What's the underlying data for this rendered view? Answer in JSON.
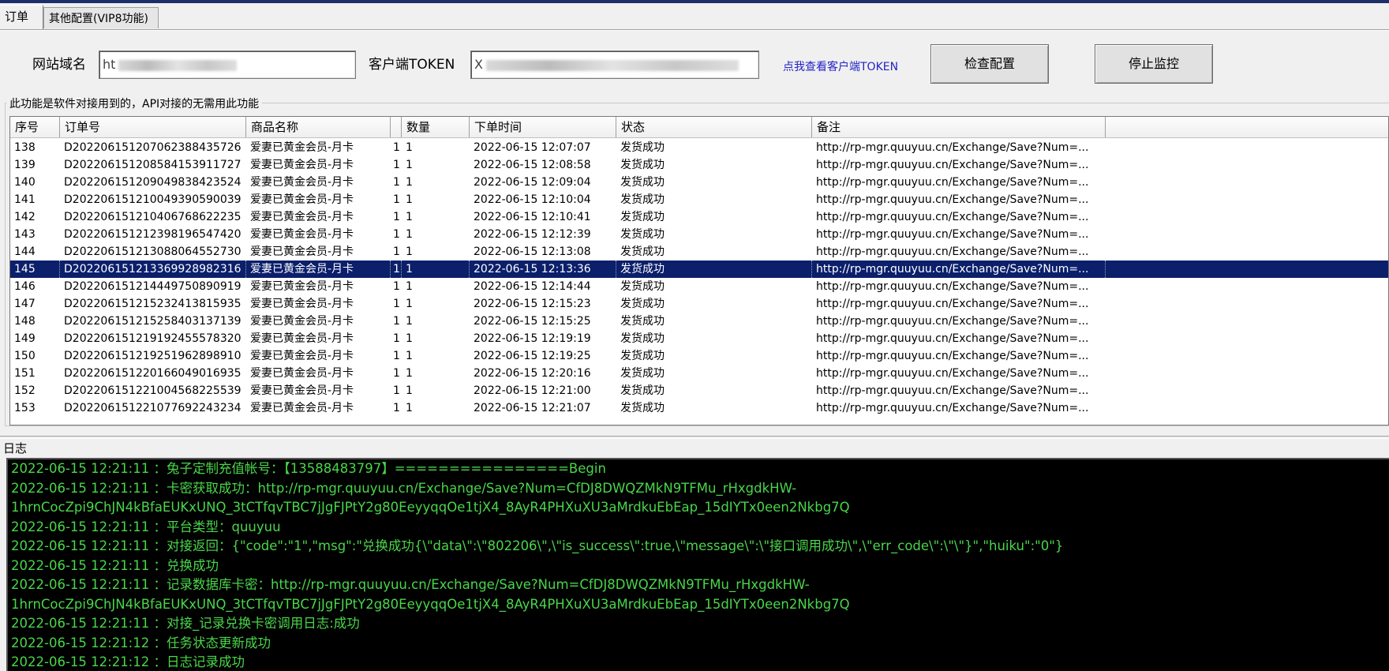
{
  "tabs": [
    {
      "label": "订单",
      "active": true
    },
    {
      "label": "其他配置(VIP8功能)",
      "active": false
    }
  ],
  "config": {
    "domain_label": "网站域名",
    "domain_value": "ht",
    "token_label": "客户端TOKEN",
    "token_value": "X",
    "token_link": "点我查看客户端TOKEN",
    "check_button": "检查配置",
    "stop_button": "停止监控"
  },
  "orders_group_title": "此功能是软件对接用到的，API对接的无需用此功能",
  "table": {
    "columns": [
      "序号",
      "订单号",
      "商品名称",
      "",
      "数量",
      "下单时间",
      "状态",
      "备注"
    ],
    "selected_row_index": 7,
    "rows": [
      [
        "138",
        "D20220615120706238843572​6",
        "爱妻已黄金会员-月卡",
        "1",
        "1",
        "2022-06-15 12:07:07",
        "发货成功",
        "http://rp-mgr.quuyuu.cn/Exchange/Save?Num=..."
      ],
      [
        "139",
        "D20220615120858415391172​7",
        "爱妻已黄金会员-月卡",
        "1",
        "1",
        "2022-06-15 12:08:58",
        "发货成功",
        "http://rp-mgr.quuyuu.cn/Exchange/Save?Num=..."
      ],
      [
        "140",
        "D20220615120904983842352​4",
        "爱妻已黄金会员-月卡",
        "1",
        "1",
        "2022-06-15 12:09:04",
        "发货成功",
        "http://rp-mgr.quuyuu.cn/Exchange/Save?Num=..."
      ],
      [
        "141",
        "D20220615121004939059003​9",
        "爱妻已黄金会员-月卡",
        "1",
        "1",
        "2022-06-15 12:10:04",
        "发货成功",
        "http://rp-mgr.quuyuu.cn/Exchange/Save?Num=..."
      ],
      [
        "142",
        "D20220615121040676862223​5",
        "爱妻已黄金会员-月卡",
        "1",
        "1",
        "2022-06-15 12:10:41",
        "发货成功",
        "http://rp-mgr.quuyuu.cn/Exchange/Save?Num=..."
      ],
      [
        "143",
        "D20220615121239819654742​0",
        "爱妻已黄金会员-月卡",
        "1",
        "1",
        "2022-06-15 12:12:39",
        "发货成功",
        "http://rp-mgr.quuyuu.cn/Exchange/Save?Num=..."
      ],
      [
        "144",
        "D20220615121308806455273​0",
        "爱妻已黄金会员-月卡",
        "1",
        "1",
        "2022-06-15 12:13:08",
        "发货成功",
        "http://rp-mgr.quuyuu.cn/Exchange/Save?Num=..."
      ],
      [
        "145",
        "D20220615121336992898231​6",
        "爱妻已黄金会员-月卡",
        "1",
        "1",
        "2022-06-15 12:13:36",
        "发货成功",
        "http://rp-mgr.quuyuu.cn/Exchange/Save?Num=..."
      ],
      [
        "146",
        "D20220615121444975089091​9",
        "爱妻已黄金会员-月卡",
        "1",
        "1",
        "2022-06-15 12:14:44",
        "发货成功",
        "http://rp-mgr.quuyuu.cn/Exchange/Save?Num=..."
      ],
      [
        "147",
        "D20220615121523241381593​5",
        "爱妻已黄金会员-月卡",
        "1",
        "1",
        "2022-06-15 12:15:23",
        "发货成功",
        "http://rp-mgr.quuyuu.cn/Exchange/Save?Num=..."
      ],
      [
        "148",
        "D20220615121525840313713​9",
        "爱妻已黄金会员-月卡",
        "1",
        "1",
        "2022-06-15 12:15:25",
        "发货成功",
        "http://rp-mgr.quuyuu.cn/Exchange/Save?Num=..."
      ],
      [
        "149",
        "D20220615121919245557832​0",
        "爱妻已黄金会员-月卡",
        "1",
        "1",
        "2022-06-15 12:19:19",
        "发货成功",
        "http://rp-mgr.quuyuu.cn/Exchange/Save?Num=..."
      ],
      [
        "150",
        "D20220615121925196289891​0",
        "爱妻已黄金会员-月卡",
        "1",
        "1",
        "2022-06-15 12:19:25",
        "发货成功",
        "http://rp-mgr.quuyuu.cn/Exchange/Save?Num=..."
      ],
      [
        "151",
        "D20220615122016604901693​5",
        "爱妻已黄金会员-月卡",
        "1",
        "1",
        "2022-06-15 12:20:16",
        "发货成功",
        "http://rp-mgr.quuyuu.cn/Exchange/Save?Num=..."
      ],
      [
        "152",
        "D20220615122100456822553​9",
        "爱妻已黄金会员-月卡",
        "1",
        "1",
        "2022-06-15 12:21:00",
        "发货成功",
        "http://rp-mgr.quuyuu.cn/Exchange/Save?Num=..."
      ],
      [
        "153",
        "D20220615122107769224323​4",
        "爱妻已黄金会员-月卡",
        "1",
        "1",
        "2022-06-15 12:21:07",
        "发货成功",
        "http://rp-mgr.quuyuu.cn/Exchange/Save?Num=..."
      ]
    ]
  },
  "log": {
    "title": "日志",
    "text_color": "#49d64a",
    "lines": [
      "2022-06-15 12:21:11 ：兔子定制充值帐号：【13588483797】================Begin",
      "2022-06-15 12:21:11 ：卡密获取成功：http://rp-mgr.quuyuu.cn/Exchange/Save?Num=CfDJ8DWQZMkN9TFMu_rHxgdkHW-",
      "1hrnCocZpi9ChJN4kBfaEUKxUNQ_3tCTfqvTBC7jJgFJPtY2g80EeyyqqOe1tjX4_8AyR4PHXuXU3aMrdkuEbEap_15dIYTx0een2Nkbg7Q",
      "2022-06-15 12:21:11 ：平台类型：quuyuu",
      "2022-06-15 12:21:11 ：对接返回：{\"code\":\"1\",\"msg\":\"兑换成功{\\\"data\\\":\\\"802206\\\",\\\"is_success\\\":true,\\\"message\\\":\\\"接口调用成功\\\",\\\"err_code\\\":\\\"\\\"}\",\"huiku\":\"0\"}",
      "2022-06-15 12:21:11 ：兑换成功",
      "2022-06-15 12:21:11 ：记录数据库卡密：http://rp-mgr.quuyuu.cn/Exchange/Save?Num=CfDJ8DWQZMkN9TFMu_rHxgdkHW-",
      "1hrnCocZpi9ChJN4kBfaEUKxUNQ_3tCTfqvTBC7jJgFJPtY2g80EeyyqqOe1tjX4_8AyR4PHXuXU3aMrdkuEbEap_15dIYTx0een2Nkbg7Q",
      "2022-06-15 12:21:11 ：对接_记录兑换卡密调用日志:成功",
      "2022-06-15 12:21:12 ：任务状态更新成功",
      "2022-06-15 12:21:12 ：日志记录成功"
    ]
  }
}
